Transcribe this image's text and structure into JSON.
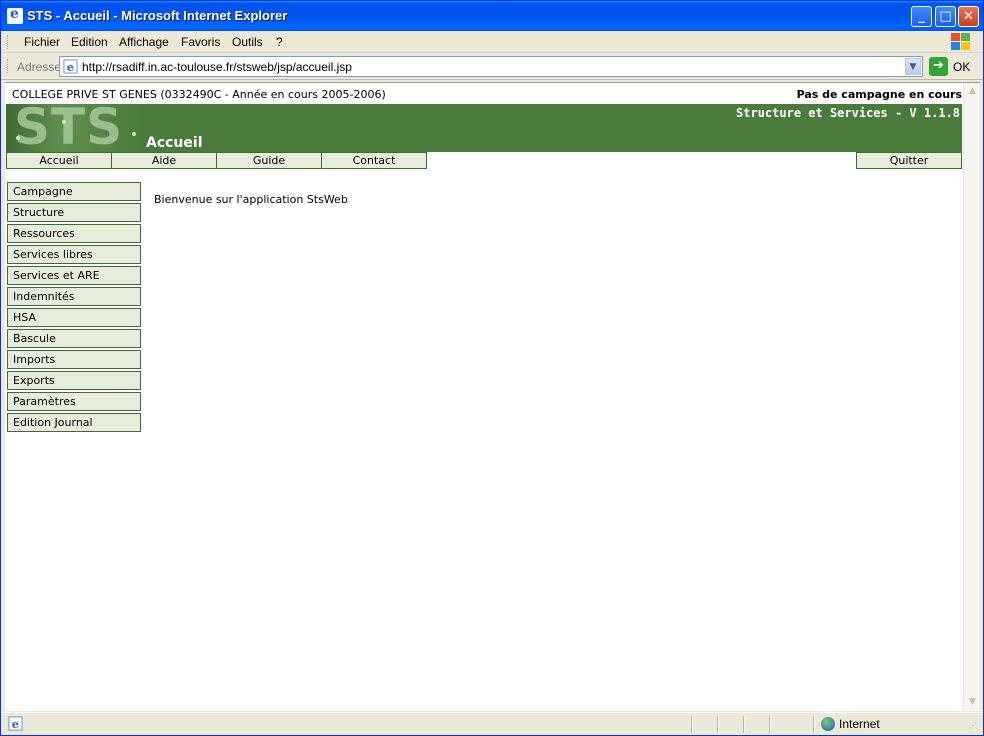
{
  "window": {
    "title": "STS - Accueil - Microsoft Internet Explorer",
    "minimize_glyph": "_",
    "maximize_glyph": "□",
    "close_glyph": "✕"
  },
  "menubar": {
    "items": [
      "Fichier",
      "Edition",
      "Affichage",
      "Favoris",
      "Outils",
      "?"
    ]
  },
  "addressbar": {
    "label": "Adresse",
    "url": "http://rsadiff.in.ac-toulouse.fr/stsweb/jsp/accueil.jsp",
    "go_label": "OK",
    "go_glyph": "➔"
  },
  "page": {
    "college": "COLLEGE PRIVE ST GENES (0332490C - Année en cours 2005-2006)",
    "campagne_status": "Pas de campagne en cours",
    "logo_text": "STS",
    "app_version": "Structure et Services - V 1.1.8",
    "page_title": "Accueil",
    "top_nav": {
      "accueil": "Accueil",
      "aide": "Aide",
      "guide": "Guide",
      "contact": "Contact",
      "quitter": "Quitter"
    },
    "sidebar": [
      "Campagne",
      "Structure",
      "Ressources",
      "Services libres",
      "Services et ARE",
      "Indemnités",
      "HSA",
      "Bascule",
      "Imports",
      "Exports",
      "Paramètres",
      "Edition Journal"
    ],
    "welcome": "Bienvenue sur l'application StsWeb"
  },
  "statusbar": {
    "zone": "Internet"
  },
  "colors": {
    "banner": "#4a7a3c",
    "tab_bg": "#e6eedb",
    "tab_border": "#3f6b35",
    "titlebar": "#0054e3"
  }
}
